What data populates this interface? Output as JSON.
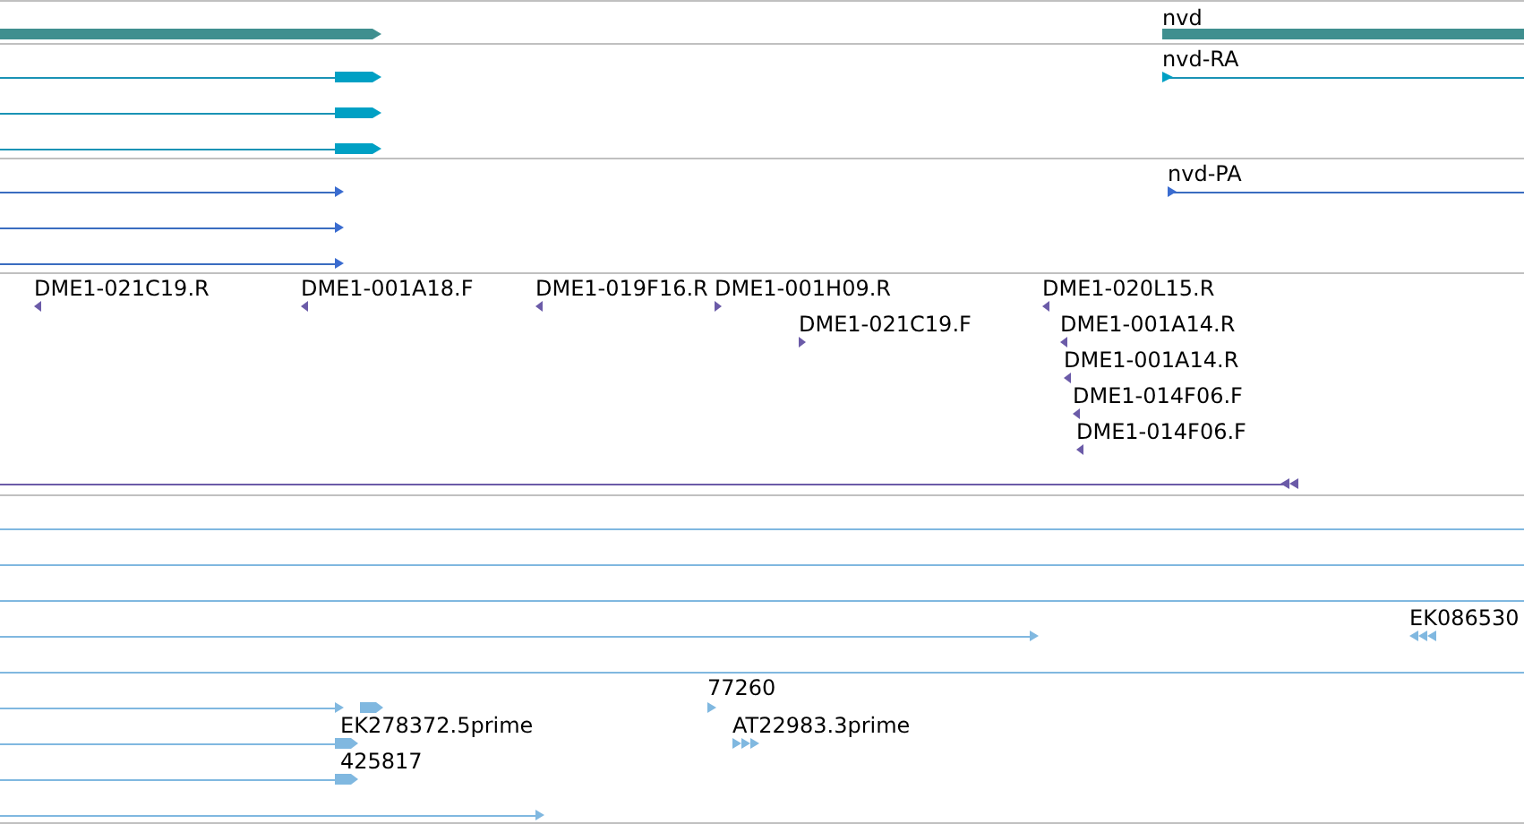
{
  "tracks": [
    {
      "kind": "gene",
      "labels": [
        "nvd"
      ]
    },
    {
      "kind": "transcript",
      "labels": [
        "nvd-RA"
      ]
    },
    {
      "kind": "protein",
      "labels": [
        "nvd-PA"
      ]
    },
    {
      "kind": "primer",
      "labels": [
        "DME1-021C19.R",
        "DME1-001A18.F",
        "DME1-019F16.R",
        "DME1-001H09.R",
        "DME1-021C19.F",
        "DME1-020L15.R",
        "DME1-001A14.R",
        "DME1-001A14.R",
        "DME1-014F06.F",
        "DME1-014F06.F"
      ]
    },
    {
      "kind": "est",
      "labels": [
        "EK086530",
        "77260",
        "EK278372.5prime",
        "AT22983.3prime",
        "425817"
      ]
    }
  ]
}
